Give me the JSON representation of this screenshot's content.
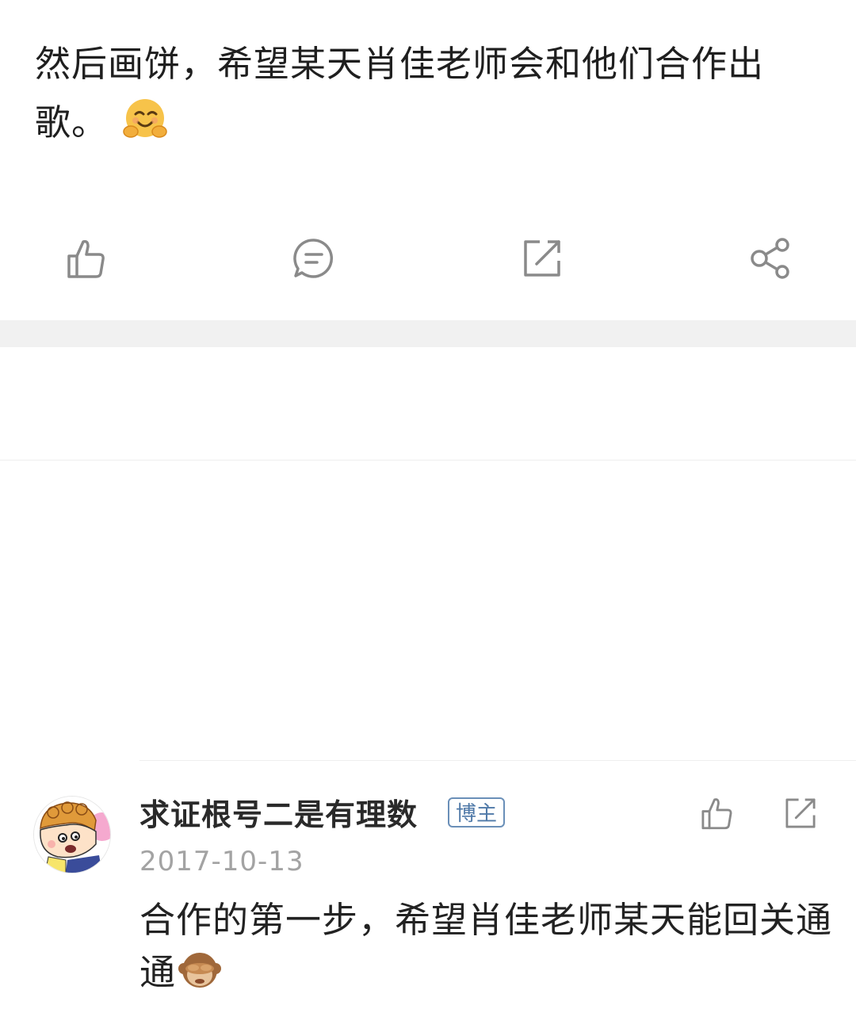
{
  "post": {
    "text": "然后画饼，希望某天肖佳老师会和他们合作出歌。",
    "emoji": "hugging-face-emoji"
  },
  "actions": {
    "like": "thumbs-up-icon",
    "comment": "comment-bubble-icon",
    "repost": "repost-icon",
    "share": "share-icon"
  },
  "comment": {
    "username": "求证根号二是有理数",
    "badge": "博主",
    "date": "2017-10-13",
    "text": "合作的第一步，希望肖佳老师某天能回关通通",
    "emoji": "see-no-evil-monkey-emoji"
  },
  "colors": {
    "icon": "#8a8a8a",
    "separator": "#f1f1f1",
    "badge": "#4f79a8",
    "date": "#a3a3a3"
  }
}
